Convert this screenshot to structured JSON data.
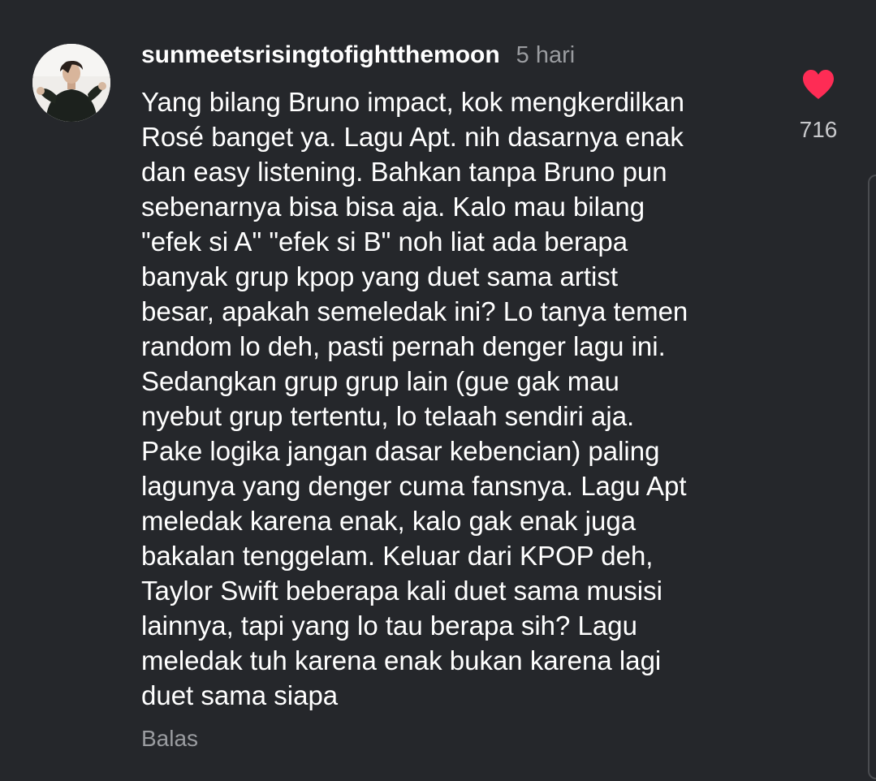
{
  "comment": {
    "username": "sunmeetsrisingtofightthemoon",
    "time": "5 hari",
    "text": "Yang bilang Bruno impact, kok mengkerdilkan\nRosé banget ya. Lagu Apt. nih dasarnya enak\ndan easy listening. Bahkan tanpa Bruno pun\nsebenarnya bisa bisa aja. Kalo mau bilang\n\"efek si A\" \"efek si B\" noh liat ada berapa\nbanyak grup kpop yang duet sama artist\nbesar, apakah semeledak ini? Lo tanya temen\nrandom lo deh, pasti pernah denger lagu ini.\nSedangkan grup grup lain (gue gak mau\nnyebut grup tertentu, lo telaah sendiri aja.\nPake logika jangan dasar kebencian) paling\nlagunya yang denger cuma fansnya. Lagu Apt\nmeledak karena enak, kalo gak enak juga\nbakalan tenggelam. Keluar dari KPOP deh,\nTaylor Swift beberapa kali duet sama musisi\nlainnya, tapi yang lo tau berapa sih? Lagu\nmeledak tuh karena enak bukan karena lagi\nduet sama siapa",
    "reply_label": "Balas",
    "like_count": "716",
    "like_icon": "heart-icon",
    "avatar_icon": "user-avatar"
  },
  "colors": {
    "background": "#25272b",
    "text": "#ffffff",
    "muted": "#9a9ca0",
    "heart": "#fe2c55"
  }
}
